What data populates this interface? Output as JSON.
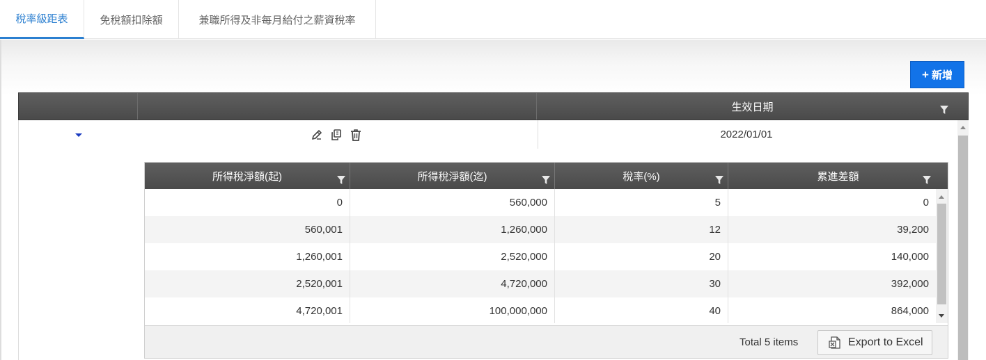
{
  "tabs": [
    {
      "label": "稅率級距表",
      "active": true
    },
    {
      "label": "免稅額扣除額",
      "active": false
    },
    {
      "label": "兼職所得及非每月給付之薪資稅率",
      "active": false
    }
  ],
  "toolbar": {
    "add_label": "新增",
    "add_icon": "plus-icon"
  },
  "outer_grid": {
    "headers": [
      "",
      "",
      "生效日期"
    ],
    "row": {
      "effective_date": "2022/01/01",
      "action_icons": [
        "edit-icon",
        "copy-icon",
        "trash-icon"
      ]
    }
  },
  "inner_grid": {
    "headers": [
      "所得稅淨額(起)",
      "所得稅淨額(迄)",
      "稅率(%)",
      "累進差額"
    ],
    "rows": [
      [
        "0",
        "560,000",
        "5",
        "0"
      ],
      [
        "560,001",
        "1,260,000",
        "12",
        "39,200"
      ],
      [
        "1,260,001",
        "2,520,000",
        "20",
        "140,000"
      ],
      [
        "2,520,001",
        "4,720,000",
        "30",
        "392,000"
      ],
      [
        "4,720,001",
        "100,000,000",
        "40",
        "864,000"
      ]
    ],
    "footer": {
      "total_text": "Total 5 items",
      "export_label": "Export to Excel"
    }
  },
  "colors": {
    "accent": "#2b7fd0",
    "button_blue": "#1273e8",
    "header_dark": "#555555"
  }
}
